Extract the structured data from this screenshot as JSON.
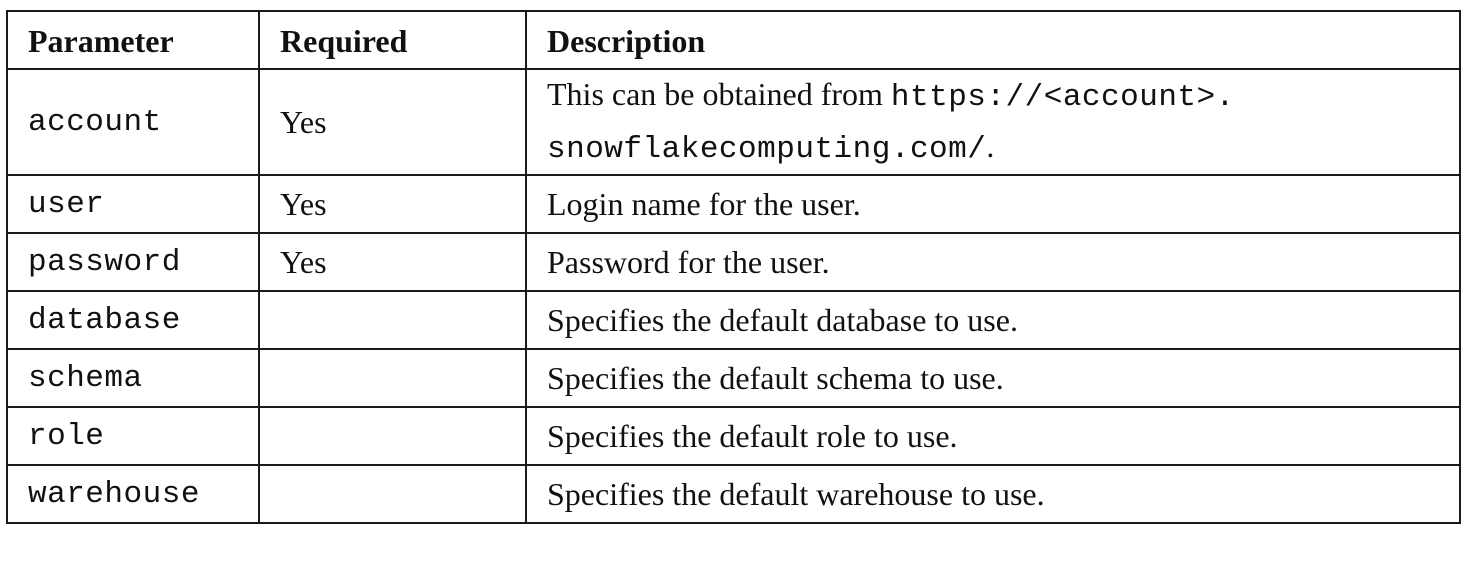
{
  "table": {
    "headers": {
      "parameter": "Parameter",
      "required": "Required",
      "description": "Description"
    },
    "rows": [
      {
        "parameter": "account",
        "required": "Yes",
        "description_prefix": "This can be obtained from ",
        "description_url_1": "https://<account>.",
        "description_url_2": "snowflakecomputing.com/",
        "description_suffix": "."
      },
      {
        "parameter": "user",
        "required": "Yes",
        "description": "Login name for the user."
      },
      {
        "parameter": "password",
        "required": "Yes",
        "description": "Password for the user."
      },
      {
        "parameter": "database",
        "required": "",
        "description": "Specifies the default database to use."
      },
      {
        "parameter": "schema",
        "required": "",
        "description": "Specifies the default schema to use."
      },
      {
        "parameter": "role",
        "required": "",
        "description": "Specifies the default role to use."
      },
      {
        "parameter": "warehouse",
        "required": "",
        "description": "Specifies the default warehouse to use."
      }
    ]
  }
}
